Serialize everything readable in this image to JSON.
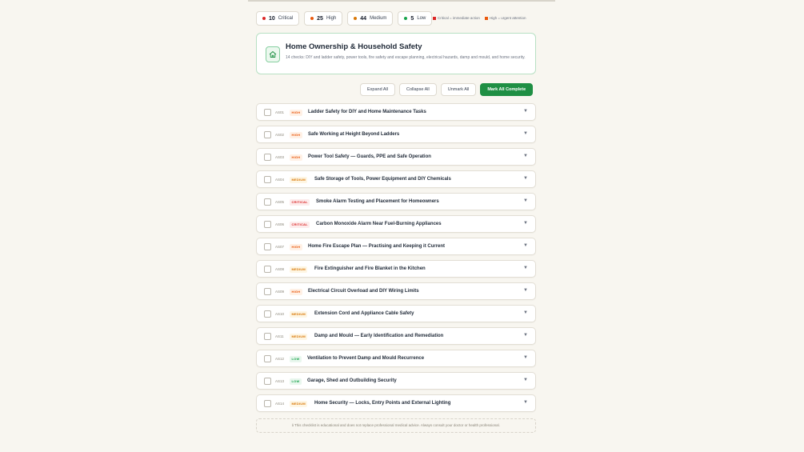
{
  "colors": {
    "critical": "#dc2626",
    "high": "#ea580c",
    "medium": "#d97706",
    "low": "#16a34a",
    "accent": "#1f8f44"
  },
  "stats": [
    {
      "count": "10",
      "label": "Critical",
      "color": "#dc2626"
    },
    {
      "count": "25",
      "label": "High",
      "color": "#ea580c"
    },
    {
      "count": "44",
      "label": "Medium",
      "color": "#d97706"
    },
    {
      "count": "5",
      "label": "Low",
      "color": "#16a34a"
    }
  ],
  "legend": [
    {
      "label": "Critical = immediate action",
      "color": "#dc2626"
    },
    {
      "label": "High = urgent attention",
      "color": "#ea580c"
    }
  ],
  "header": {
    "icon": "home-icon",
    "title": "Home Ownership & Household Safety",
    "description": "14 checks: DIY and ladder safety, power tools, fire safety and escape planning, electrical hazards, damp and mould, and home security."
  },
  "actions": {
    "expand_all": "Expand All",
    "collapse_all": "Collapse All",
    "unmark_all": "Unmark All",
    "mark_all": "Mark All Complete"
  },
  "items": [
    {
      "code": "AS01",
      "priority": "HIGH",
      "title": "Ladder Safety for DIY and Home Maintenance Tasks"
    },
    {
      "code": "AS02",
      "priority": "HIGH",
      "title": "Safe Working at Height Beyond Ladders"
    },
    {
      "code": "AS03",
      "priority": "HIGH",
      "title": "Power Tool Safety — Guards, PPE and Safe Operation"
    },
    {
      "code": "AS04",
      "priority": "MEDIUM",
      "title": "Safe Storage of Tools, Power Equipment and DIY Chemicals"
    },
    {
      "code": "AS05",
      "priority": "CRITICAL",
      "title": "Smoke Alarm Testing and Placement for Homeowners"
    },
    {
      "code": "AS06",
      "priority": "CRITICAL",
      "title": "Carbon Monoxide Alarm Near Fuel-Burning Appliances"
    },
    {
      "code": "AS07",
      "priority": "HIGH",
      "title": "Home Fire Escape Plan — Practising and Keeping it Current"
    },
    {
      "code": "AS08",
      "priority": "MEDIUM",
      "title": "Fire Extinguisher and Fire Blanket in the Kitchen"
    },
    {
      "code": "AS09",
      "priority": "HIGH",
      "title": "Electrical Circuit Overload and DIY Wiring Limits"
    },
    {
      "code": "AS10",
      "priority": "MEDIUM",
      "title": "Extension Cord and Appliance Cable Safety"
    },
    {
      "code": "AS11",
      "priority": "MEDIUM",
      "title": "Damp and Mould — Early Identification and Remediation"
    },
    {
      "code": "AS12",
      "priority": "LOW",
      "title": "Ventilation to Prevent Damp and Mould Recurrence"
    },
    {
      "code": "AS13",
      "priority": "LOW",
      "title": "Garage, Shed and Outbuilding Security"
    },
    {
      "code": "AS14",
      "priority": "MEDIUM",
      "title": "Home Security — Locks, Entry Points and External Lighting"
    }
  ],
  "disclaimer": "ℹ This checklist is educational and does not replace professional medical advice. Always consult your doctor or health professional."
}
